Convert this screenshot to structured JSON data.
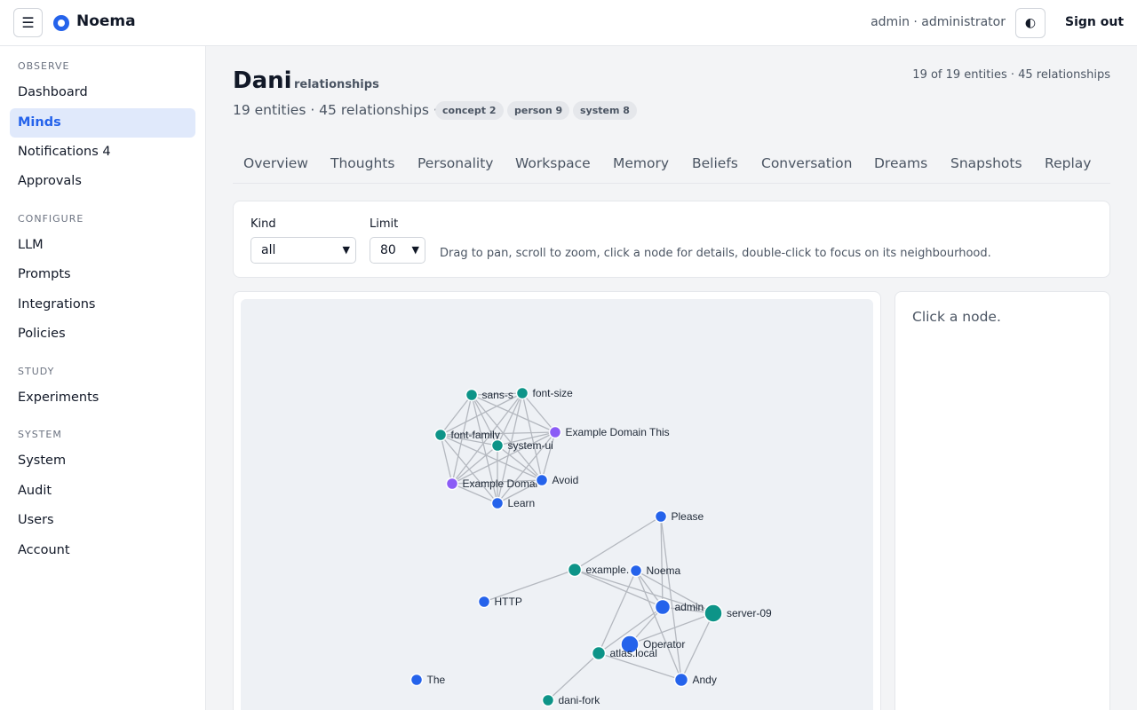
{
  "header": {
    "menu_icon": "☰",
    "brand": "Noema",
    "user": "admin · administrator",
    "theme_icon": "◐",
    "signout": "Sign out"
  },
  "sidebar": {
    "sections": [
      {
        "title": "OBSERVE",
        "items": [
          {
            "label": "Dashboard"
          },
          {
            "label": "Minds",
            "active": true
          },
          {
            "label": "Notifications 4"
          },
          {
            "label": "Approvals"
          }
        ]
      },
      {
        "title": "CONFIGURE",
        "items": [
          {
            "label": "LLM"
          },
          {
            "label": "Prompts"
          },
          {
            "label": "Integrations"
          },
          {
            "label": "Policies"
          }
        ]
      },
      {
        "title": "STUDY",
        "items": [
          {
            "label": "Experiments"
          }
        ]
      },
      {
        "title": "SYSTEM",
        "items": [
          {
            "label": "System"
          },
          {
            "label": "Audit"
          },
          {
            "label": "Users"
          },
          {
            "label": "Account"
          }
        ]
      }
    ]
  },
  "page": {
    "title": "Dani",
    "subtitle": "relationships",
    "counts_right": "19 of 19 entities · 45 relationships",
    "stats": "19 entities · 45 relationships ·",
    "pills": [
      "concept 2",
      "person 9",
      "system 8"
    ]
  },
  "tabs": [
    "Overview",
    "Thoughts",
    "Personality",
    "Workspace",
    "Memory",
    "Beliefs",
    "Conversation",
    "Dreams",
    "Snapshots",
    "Replay"
  ],
  "filters": {
    "kind_label": "Kind",
    "kind_value": "all",
    "limit_label": "Limit",
    "limit_value": "80",
    "hint": "Drag to pan, scroll to zoom, click a node for details, double-click to focus on its neighbourhood."
  },
  "detail": {
    "placeholder": "Click a node."
  },
  "colors": {
    "system": "#0d9488",
    "person": "#2563eb",
    "concept": "#8b5cf6",
    "edge": "#b4b8bf"
  },
  "graph": {
    "nodes": [
      {
        "id": "sans-s",
        "label": "sans-s",
        "kind": "system"
      },
      {
        "id": "font-size",
        "label": "font-size",
        "kind": "system"
      },
      {
        "id": "font-family",
        "label": "font-family",
        "kind": "system"
      },
      {
        "id": "system-ui",
        "label": "system-ui",
        "kind": "system"
      },
      {
        "id": "ex-domain-this",
        "label": "Example Domain This",
        "kind": "concept"
      },
      {
        "id": "ex-domain",
        "label": "Example Domai",
        "kind": "concept"
      },
      {
        "id": "avoid",
        "label": "Avoid",
        "kind": "person"
      },
      {
        "id": "learn",
        "label": "Learn",
        "kind": "person"
      },
      {
        "id": "please",
        "label": "Please",
        "kind": "person"
      },
      {
        "id": "example",
        "label": "example.",
        "kind": "system"
      },
      {
        "id": "noema",
        "label": "Noema",
        "kind": "person"
      },
      {
        "id": "http",
        "label": "HTTP",
        "kind": "person"
      },
      {
        "id": "admin",
        "label": "admin",
        "kind": "person"
      },
      {
        "id": "server-09",
        "label": "server-09",
        "kind": "system"
      },
      {
        "id": "operator",
        "label": "Operator",
        "kind": "person"
      },
      {
        "id": "atlas",
        "label": "atlas.local",
        "kind": "system"
      },
      {
        "id": "andy",
        "label": "Andy",
        "kind": "person"
      },
      {
        "id": "the",
        "label": "The",
        "kind": "person"
      },
      {
        "id": "dani-fork",
        "label": "dani-fork",
        "kind": "system"
      }
    ],
    "edges": [
      [
        "sans-s",
        "font-size"
      ],
      [
        "sans-s",
        "font-family"
      ],
      [
        "sans-s",
        "system-ui"
      ],
      [
        "sans-s",
        "ex-domain-this"
      ],
      [
        "sans-s",
        "ex-domain"
      ],
      [
        "sans-s",
        "avoid"
      ],
      [
        "sans-s",
        "learn"
      ],
      [
        "font-size",
        "font-family"
      ],
      [
        "font-size",
        "system-ui"
      ],
      [
        "font-size",
        "ex-domain-this"
      ],
      [
        "font-size",
        "ex-domain"
      ],
      [
        "font-size",
        "avoid"
      ],
      [
        "font-size",
        "learn"
      ],
      [
        "font-family",
        "system-ui"
      ],
      [
        "font-family",
        "ex-domain-this"
      ],
      [
        "font-family",
        "ex-domain"
      ],
      [
        "font-family",
        "avoid"
      ],
      [
        "font-family",
        "learn"
      ],
      [
        "system-ui",
        "ex-domain-this"
      ],
      [
        "system-ui",
        "ex-domain"
      ],
      [
        "system-ui",
        "avoid"
      ],
      [
        "system-ui",
        "learn"
      ],
      [
        "ex-domain-this",
        "ex-domain"
      ],
      [
        "ex-domain-this",
        "avoid"
      ],
      [
        "ex-domain-this",
        "learn"
      ],
      [
        "ex-domain",
        "avoid"
      ],
      [
        "ex-domain",
        "learn"
      ],
      [
        "avoid",
        "learn"
      ],
      [
        "please",
        "example"
      ],
      [
        "please",
        "admin"
      ],
      [
        "please",
        "andy"
      ],
      [
        "example",
        "http"
      ],
      [
        "example",
        "admin"
      ],
      [
        "example",
        "server-09"
      ],
      [
        "noema",
        "admin"
      ],
      [
        "noema",
        "server-09"
      ],
      [
        "noema",
        "atlas"
      ],
      [
        "noema",
        "andy"
      ],
      [
        "admin",
        "server-09"
      ],
      [
        "admin",
        "atlas"
      ],
      [
        "admin",
        "operator"
      ],
      [
        "server-09",
        "operator"
      ],
      [
        "server-09",
        "andy"
      ],
      [
        "atlas",
        "andy"
      ],
      [
        "atlas",
        "dani-fork"
      ]
    ]
  }
}
